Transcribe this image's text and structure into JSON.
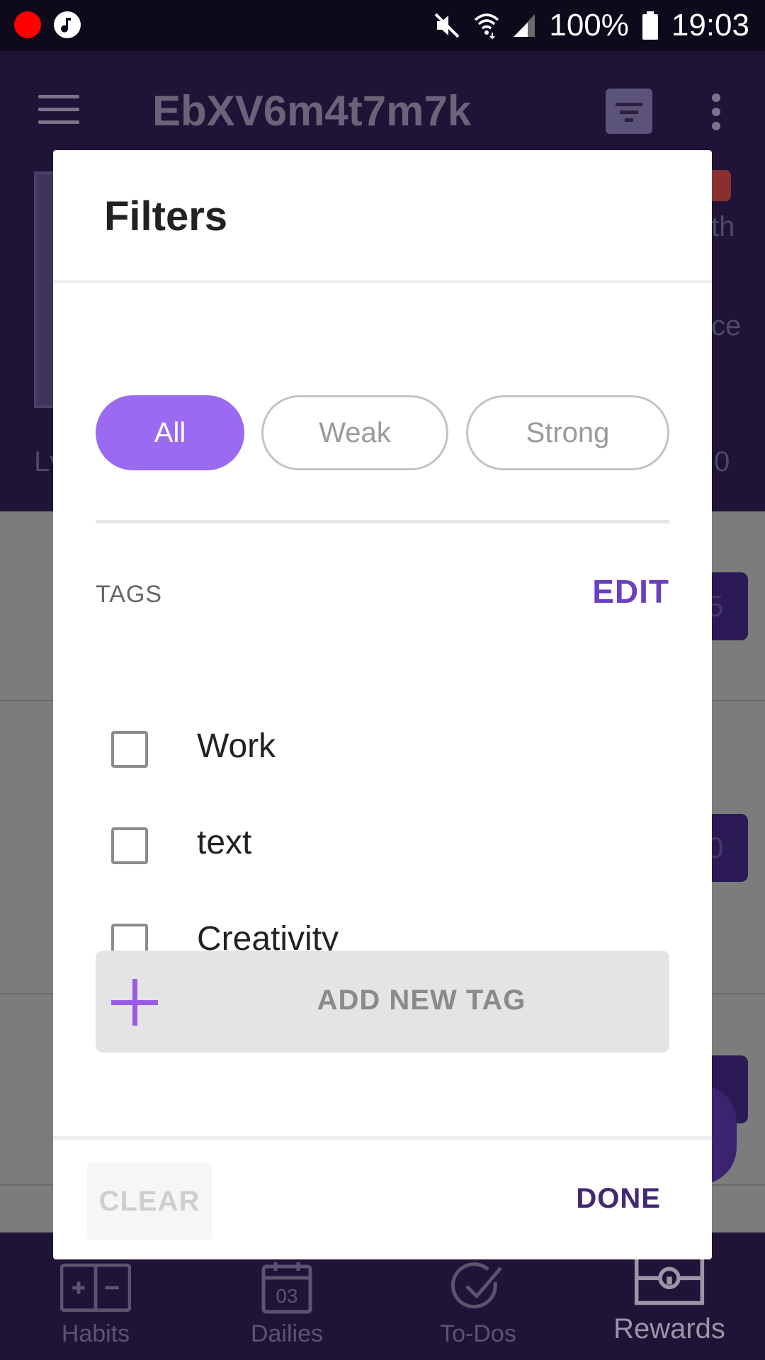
{
  "status_bar": {
    "battery": "100%",
    "time": "19:03",
    "icons": [
      "record-icon",
      "music-icon",
      "mute-icon",
      "wifi-icon",
      "signal-icon",
      "battery-icon"
    ]
  },
  "app": {
    "title": "EbXV6m4t7m7k",
    "background_fragments": {
      "right_1": "th",
      "right_2": "ce",
      "left_level": "Lv",
      "right_num": "0",
      "chip_1": "5",
      "chip_2": "0"
    },
    "bottom_nav": [
      {
        "label": "Habits",
        "icon": "habits-icon"
      },
      {
        "label": "Dailies",
        "icon": "dailies-icon",
        "icon_text": "03"
      },
      {
        "label": "To-Dos",
        "icon": "todos-icon"
      },
      {
        "label": "Rewards",
        "icon": "rewards-icon"
      }
    ]
  },
  "dialog": {
    "title": "Filters",
    "segments": [
      {
        "label": "All",
        "active": true
      },
      {
        "label": "Weak",
        "active": false
      },
      {
        "label": "Strong",
        "active": false
      }
    ],
    "tags_label": "TAGS",
    "edit_label": "EDIT",
    "tags": [
      {
        "label": "Work",
        "checked": false
      },
      {
        "label": "text",
        "checked": false
      },
      {
        "label": "Creativity",
        "checked": false
      }
    ],
    "add_tag_label": "ADD NEW TAG",
    "clear_label": "CLEAR",
    "done_label": "DONE"
  },
  "colors": {
    "accent": "#9a6af1",
    "done_text": "#432874",
    "edit_text": "#6b3fbf",
    "overlay_header": "#1f1438"
  }
}
